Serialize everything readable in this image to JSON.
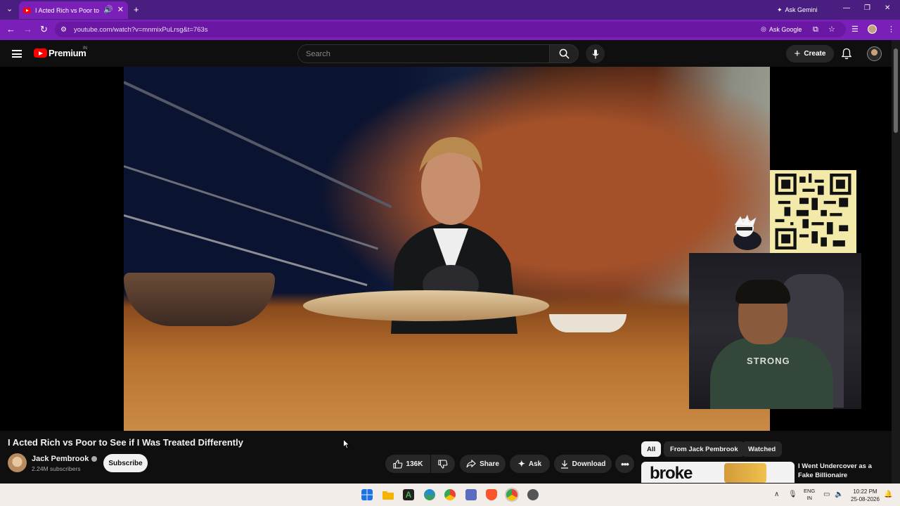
{
  "browser": {
    "tab_title": "I Acted Rich vs Poor to See",
    "new_tab_glyph": "+",
    "ask_gemini": "Ask Gemini",
    "url": "youtube.com/watch?v=mnmixPuLrsg&t=763s",
    "ask_google": "Ask Google",
    "window_controls": [
      "—",
      "❐",
      "✕"
    ]
  },
  "youtube_header": {
    "brand": "Premium",
    "region": "IN",
    "search_placeholder": "Search",
    "create_label": "Create"
  },
  "overlay": {
    "shirt_text": "STRONG"
  },
  "video": {
    "title": "I Acted Rich vs Poor to See if I Was Treated Differently",
    "channel_name": "Jack Pembrook",
    "subscribers": "2.24M subscribers",
    "subscribe_label": "Subscribe",
    "likes": "136K",
    "share_label": "Share",
    "ask_label": "Ask",
    "download_label": "Download"
  },
  "recommendations": {
    "chips": [
      "All",
      "From Jack Pembrook",
      "Watched"
    ],
    "first_item": {
      "thumbnail_text": "broke",
      "title": "I Went Undercover as a Fake Billionaire"
    }
  },
  "taskbar": {
    "language": "ENG",
    "region": "IN",
    "time": "10:22 PM",
    "date": "25-08-2026"
  },
  "colors": {
    "tab_strip": "#4a1d80",
    "toolbar": "#7a1fb8",
    "youtube_bg": "#0f0f0f",
    "youtube_red": "#ff0000"
  }
}
